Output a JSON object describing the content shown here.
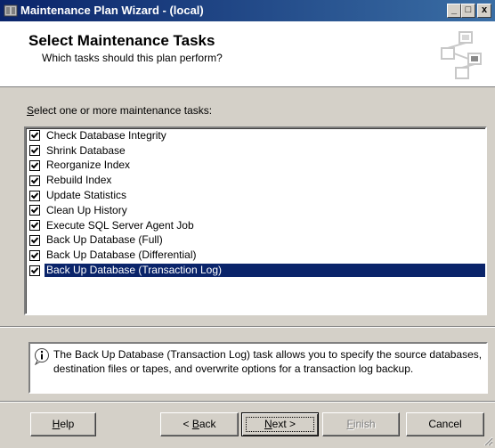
{
  "window": {
    "title": "Maintenance Plan Wizard - (local)",
    "controls": {
      "minimize": "_",
      "maximize": "□",
      "close": "x"
    }
  },
  "header": {
    "title": "Select Maintenance Tasks",
    "subtitle": "Which tasks should this plan perform?"
  },
  "prompt": {
    "mnemonic": "S",
    "rest": "elect one or more maintenance tasks:"
  },
  "tasks": [
    {
      "label": "Check Database Integrity",
      "checked": true,
      "selected": false
    },
    {
      "label": "Shrink Database",
      "checked": true,
      "selected": false
    },
    {
      "label": "Reorganize Index",
      "checked": true,
      "selected": false
    },
    {
      "label": "Rebuild Index",
      "checked": true,
      "selected": false
    },
    {
      "label": "Update Statistics",
      "checked": true,
      "selected": false
    },
    {
      "label": "Clean Up History",
      "checked": true,
      "selected": false
    },
    {
      "label": "Execute SQL Server Agent Job",
      "checked": true,
      "selected": false
    },
    {
      "label": "Back Up Database (Full)",
      "checked": true,
      "selected": false
    },
    {
      "label": "Back Up Database (Differential)",
      "checked": true,
      "selected": false
    },
    {
      "label": "Back Up Database (Transaction Log)",
      "checked": true,
      "selected": true
    }
  ],
  "description": {
    "text": "The Back Up Database (Transaction Log) task allows you to specify the source databases, destination files or tapes, and overwrite options for a transaction log backup."
  },
  "buttons": {
    "help": {
      "mnemonic": "H",
      "rest": "elp"
    },
    "back": {
      "prefix": "< ",
      "mnemonic": "B",
      "rest": "ack"
    },
    "next": {
      "mnemonic": "N",
      "rest": "ext >"
    },
    "finish": {
      "mnemonic": "F",
      "rest": "inish",
      "enabled": false
    },
    "cancel": {
      "label": "Cancel"
    }
  },
  "colors": {
    "titlebar_start": "#0a246a",
    "titlebar_end": "#3a6ea5",
    "selection": "#0a246a",
    "face": "#d4d0c8"
  }
}
